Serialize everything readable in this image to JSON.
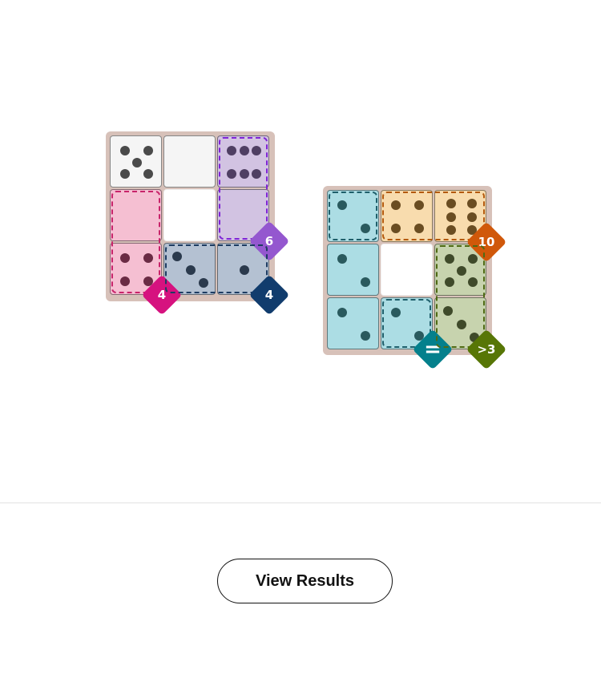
{
  "colors": {
    "board": "#d7c1b9",
    "white": "#f5f5f5",
    "pink": "#f5bfd2",
    "lavender": "#d2c3e2",
    "slate": "#b4c1d2",
    "teal": "#acdde4",
    "peach": "#f8dcae",
    "sage": "#c7d3ae",
    "badge_pink": "#d6127f",
    "badge_purple": "#9457cf",
    "badge_navy": "#113c6d",
    "badge_orange": "#d0580a",
    "badge_teal": "#04808c",
    "badge_green": "#577606"
  },
  "boards": [
    {
      "id": "puzzle-1",
      "cells": [
        {
          "row": 0,
          "col": 0,
          "color": "#f5f5f5",
          "pip_color": "#4a4a4a",
          "value": 5
        },
        {
          "row": 0,
          "col": 1,
          "color": "#f5f5f5",
          "pip_color": "#4a4a4a",
          "value": 0
        },
        {
          "row": 0,
          "col": 2,
          "color": "#d2c3e2",
          "pip_color": "#4f3f63",
          "value": 6
        },
        {
          "row": 1,
          "col": 0,
          "color": "#f5bfd2",
          "pip_color": "#6a2b44",
          "value": 0
        },
        {
          "row": 1,
          "col": 1,
          "empty": true
        },
        {
          "row": 1,
          "col": 2,
          "color": "#d2c3e2",
          "pip_color": "#4f3f63",
          "value": 0
        },
        {
          "row": 2,
          "col": 0,
          "color": "#f5bfd2",
          "pip_color": "#6a2b44",
          "value": 4
        },
        {
          "row": 2,
          "col": 1,
          "color": "#b4c1d2",
          "pip_color": "#2b3a4d",
          "value": 3
        },
        {
          "row": 2,
          "col": 2,
          "color": "#b4c1d2",
          "pip_color": "#2b3a4d",
          "value": 1
        }
      ],
      "regions": [
        {
          "cells": [
            [
              0,
              2
            ],
            [
              1,
              2
            ]
          ],
          "border": "#7f24d6",
          "badge": "6",
          "badge_color": "#9457cf",
          "anchor": [
            1,
            2
          ]
        },
        {
          "cells": [
            [
              1,
              0
            ],
            [
              2,
              0
            ]
          ],
          "border": "#c8246a",
          "badge": "4",
          "badge_color": "#d6127f",
          "anchor": [
            2,
            0
          ]
        },
        {
          "cells": [
            [
              2,
              1
            ],
            [
              2,
              2
            ]
          ],
          "border": "#1d3c62",
          "badge": "4",
          "badge_color": "#113c6d",
          "anchor": [
            2,
            2
          ]
        }
      ]
    },
    {
      "id": "puzzle-2",
      "cells": [
        {
          "row": 0,
          "col": 0,
          "color": "#acdde4",
          "pip_color": "#2a5a5e",
          "value": 2
        },
        {
          "row": 0,
          "col": 1,
          "color": "#f8dcae",
          "pip_color": "#6a4d22",
          "value": 4
        },
        {
          "row": 0,
          "col": 2,
          "color": "#f8dcae",
          "pip_color": "#6a4d22",
          "value": 6
        },
        {
          "row": 1,
          "col": 0,
          "color": "#acdde4",
          "pip_color": "#2a5a5e",
          "value": 2
        },
        {
          "row": 1,
          "col": 1,
          "empty": true
        },
        {
          "row": 1,
          "col": 2,
          "color": "#c7d3ae",
          "pip_color": "#3f4a2a",
          "value": 5
        },
        {
          "row": 2,
          "col": 0,
          "color": "#acdde4",
          "pip_color": "#2a5a5e",
          "value": 2
        },
        {
          "row": 2,
          "col": 1,
          "color": "#acdde4",
          "pip_color": "#2a5a5e",
          "value": 2
        },
        {
          "row": 2,
          "col": 2,
          "color": "#c7d3ae",
          "pip_color": "#3f4a2a",
          "value": 3
        }
      ],
      "regions": [
        {
          "cells": [
            [
              0,
              0
            ]
          ],
          "border": "#1f5f6b",
          "badge": "",
          "badge_color": "",
          "anchor": null
        },
        {
          "cells": [
            [
              0,
              1
            ],
            [
              0,
              2
            ]
          ],
          "border": "#b45a0e",
          "badge": "10",
          "badge_color": "#d0580a",
          "anchor": [
            0,
            2
          ]
        },
        {
          "cells": [
            [
              2,
              1
            ]
          ],
          "border": "#1f5f6b",
          "badge": "=",
          "badge_color": "#04808c",
          "anchor": [
            2,
            1
          ]
        },
        {
          "cells": [
            [
              1,
              2
            ],
            [
              2,
              2
            ]
          ],
          "border": "#4f6a14",
          "badge": ">3",
          "badge_color": "#577606",
          "anchor": [
            2,
            2
          ]
        }
      ]
    }
  ],
  "actions": {
    "view_results_label": "View Results"
  }
}
